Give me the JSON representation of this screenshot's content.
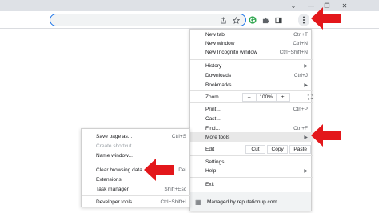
{
  "window_controls": {
    "chevron": "⌄",
    "minimize": "—",
    "restore": "❐",
    "close": "✕"
  },
  "toolbar_icons": [
    "share-icon",
    "star-icon",
    "extension-g-icon",
    "puzzle-icon",
    "sidebar-icon",
    "kebab-menu-icon"
  ],
  "menu": {
    "new_tab": {
      "label": "New tab",
      "shortcut": "Ctrl+T"
    },
    "new_window": {
      "label": "New window",
      "shortcut": "Ctrl+N"
    },
    "new_incognito": {
      "label": "New Incognito window",
      "shortcut": "Ctrl+Shift+N"
    },
    "history": {
      "label": "History"
    },
    "downloads": {
      "label": "Downloads",
      "shortcut": "Ctrl+J"
    },
    "bookmarks": {
      "label": "Bookmarks"
    },
    "zoom": {
      "label": "Zoom",
      "minus": "–",
      "value": "100%",
      "plus": "+"
    },
    "print": {
      "label": "Print...",
      "shortcut": "Ctrl+P"
    },
    "cast": {
      "label": "Cast..."
    },
    "find": {
      "label": "Find...",
      "shortcut": "Ctrl+F"
    },
    "more_tools": {
      "label": "More tools"
    },
    "edit": {
      "label": "Edit",
      "cut": "Cut",
      "copy": "Copy",
      "paste": "Paste"
    },
    "settings": {
      "label": "Settings"
    },
    "help": {
      "label": "Help"
    },
    "exit": {
      "label": "Exit"
    },
    "managed": {
      "label": "Managed by reputationup.com"
    }
  },
  "submenu": {
    "save_page": {
      "label": "Save page as...",
      "shortcut": "Ctrl+S"
    },
    "create_shortcut": {
      "label": "Create shortcut..."
    },
    "name_window": {
      "label": "Name window..."
    },
    "clear_browsing": {
      "label": "Clear browsing data...",
      "shortcut": "Del"
    },
    "extensions": {
      "label": "Extensions"
    },
    "task_manager": {
      "label": "Task manager",
      "shortcut": "Shift+Esc"
    },
    "developer_tools": {
      "label": "Developer tools",
      "shortcut": "Ctrl+Shift+I"
    }
  },
  "colors": {
    "accent_red": "#e3171b",
    "hover": "#e8e8e8",
    "chrome": "#dee1e6"
  }
}
